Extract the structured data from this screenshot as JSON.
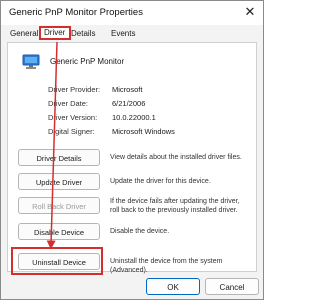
{
  "window": {
    "title": "Generic PnP Monitor Properties",
    "close_glyph": "✕"
  },
  "tabs": [
    {
      "label": "General"
    },
    {
      "label": "Driver"
    },
    {
      "label": "Details"
    },
    {
      "label": "Events"
    }
  ],
  "device": {
    "name": "Generic PnP Monitor",
    "icon": "monitor-icon"
  },
  "properties": [
    {
      "label": "Driver Provider:",
      "value": "Microsoft"
    },
    {
      "label": "Driver Date:",
      "value": "6/21/2006"
    },
    {
      "label": "Driver Version:",
      "value": "10.0.22000.1"
    },
    {
      "label": "Digital Signer:",
      "value": "Microsoft Windows"
    }
  ],
  "actions": [
    {
      "label": "Driver Details",
      "description": "View details about the installed driver files.",
      "enabled": true
    },
    {
      "label": "Update Driver",
      "description": "Update the driver for this device.",
      "enabled": true
    },
    {
      "label": "Roll Back Driver",
      "description": "If the device fails after updating the driver, roll back to the previously installed driver.",
      "enabled": false
    },
    {
      "label": "Disable Device",
      "description": "Disable the device.",
      "enabled": true
    },
    {
      "label": "Uninstall Device",
      "description": "Uninstall the device from the system (Advanced).",
      "enabled": true
    }
  ],
  "footer": {
    "ok": "OK",
    "cancel": "Cancel"
  },
  "colors": {
    "highlight": "#d32f2f",
    "accent": "#0067c0"
  }
}
